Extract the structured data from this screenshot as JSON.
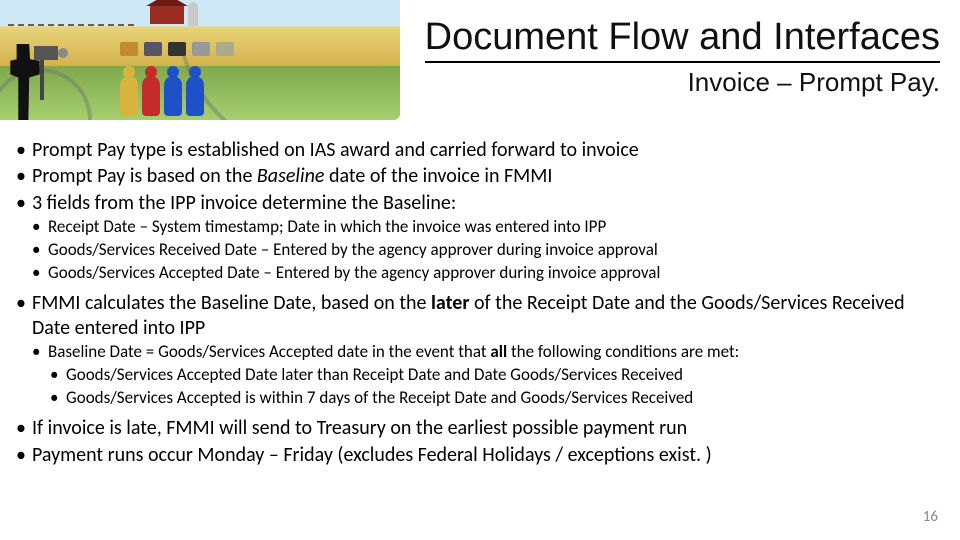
{
  "title": "Document Flow and Interfaces",
  "subtitle": "Invoice – Prompt Pay.",
  "page_number": "16",
  "bullets": {
    "l1_a": "Prompt Pay type is established on IAS award and carried forward to invoice",
    "l1_b_pre": "Prompt Pay is based on the ",
    "l1_b_em": "Baseline",
    "l1_b_post": " date of the invoice in FMMI",
    "l1_c": "3 fields from the IPP invoice determine the Baseline:",
    "l2_a": "Receipt Date – System timestamp; Date in which the invoice was entered into IPP",
    "l2_b": "Goods/Services Received Date – Entered by the agency approver during invoice approval",
    "l2_c": "Goods/Services Accepted Date – Entered by the agency approver during invoice approval",
    "l1_d_pre": "FMMI calculates the Baseline Date, based on the ",
    "l1_d_b": "later",
    "l1_d_post": " of the Receipt Date and the Goods/Services Received Date entered into IPP",
    "l2_d_pre": "Baseline Date = Goods/Services Accepted date in the event that ",
    "l2_d_b": "all",
    "l2_d_post": " the following conditions are met:",
    "l3_a": "Goods/Services Accepted Date later than Receipt Date and Date Goods/Services Received",
    "l3_b": "Goods/Services Accepted is within 7 days of the Receipt Date and Goods/Services Received",
    "l1_e": "If invoice is late, FMMI will send to Treasury on the earliest possible payment run",
    "l1_f": "Payment runs occur Monday – Friday (excludes Federal Holidays / exceptions exist. )"
  }
}
